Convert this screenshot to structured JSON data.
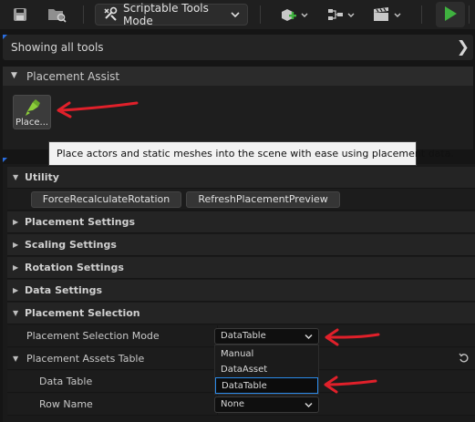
{
  "toolbar": {
    "mode_label": "Scriptable Tools Mode",
    "icons": [
      "save-icon",
      "browse-folder-icon",
      "scriptable-tools-icon",
      "add-actor-icon",
      "blueprint-icon",
      "cinematics-icon",
      "play-icon"
    ]
  },
  "filter": {
    "text": "Showing all tools",
    "chevron": "❯"
  },
  "placement_assist": {
    "title": "Placement Assist",
    "tool_label": "Place...",
    "tooltip": "Place actors and static meshes into the scene with ease using placement data."
  },
  "details": {
    "utility": {
      "label": "Utility",
      "buttons": [
        "ForceRecalculateRotation",
        "RefreshPlacementPreview"
      ]
    },
    "categories": [
      "Placement Settings",
      "Scaling Settings",
      "Rotation Settings",
      "Data Settings"
    ],
    "placement_selection": {
      "label": "Placement Selection",
      "mode_label": "Placement Selection Mode",
      "mode_value": "DataTable",
      "options": [
        "Manual",
        "DataAsset",
        "DataTable"
      ],
      "assets_table_label": "Placement Assets Table",
      "data_table_label": "Data Table",
      "row_name_label": "Row Name",
      "row_name_value": "None"
    }
  },
  "colors": {
    "accent_blue": "#2b8ae8",
    "play_green": "#3fb13f",
    "annotation_red": "#e0202a"
  }
}
